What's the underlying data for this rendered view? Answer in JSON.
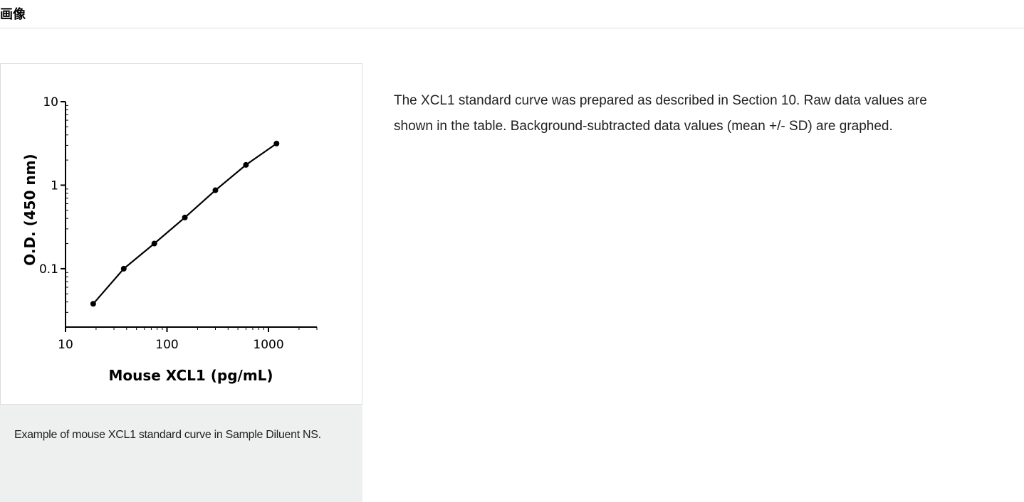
{
  "header": {
    "title": "画像"
  },
  "figure": {
    "caption": "Example of mouse XCL1 standard curve in Sample Diluent NS."
  },
  "description": {
    "text": "The XCL1 standard curve was prepared as described in Section 10. Raw data values are shown in the table. Background-subtracted data values (mean +/- SD) are graphed."
  },
  "chart_data": {
    "type": "line",
    "title": "",
    "xlabel": "Mouse XCL1 (pg/mL)",
    "ylabel": "O.D. (450 nm)",
    "x_scale": "log",
    "y_scale": "log",
    "xlim": [
      10,
      3000
    ],
    "ylim": [
      0.02,
      10
    ],
    "x_ticks": [
      10,
      100,
      1000
    ],
    "x_tick_labels": [
      "10",
      "100",
      "1000"
    ],
    "y_ticks": [
      0.1,
      1,
      10
    ],
    "y_tick_labels": [
      "0.1",
      "1",
      "10"
    ],
    "grid": false,
    "series": [
      {
        "x": [
          18.75,
          37.5,
          75,
          150,
          300,
          600,
          1200
        ],
        "y": [
          0.038,
          0.1,
          0.2,
          0.41,
          0.87,
          1.75,
          3.15
        ]
      }
    ]
  }
}
